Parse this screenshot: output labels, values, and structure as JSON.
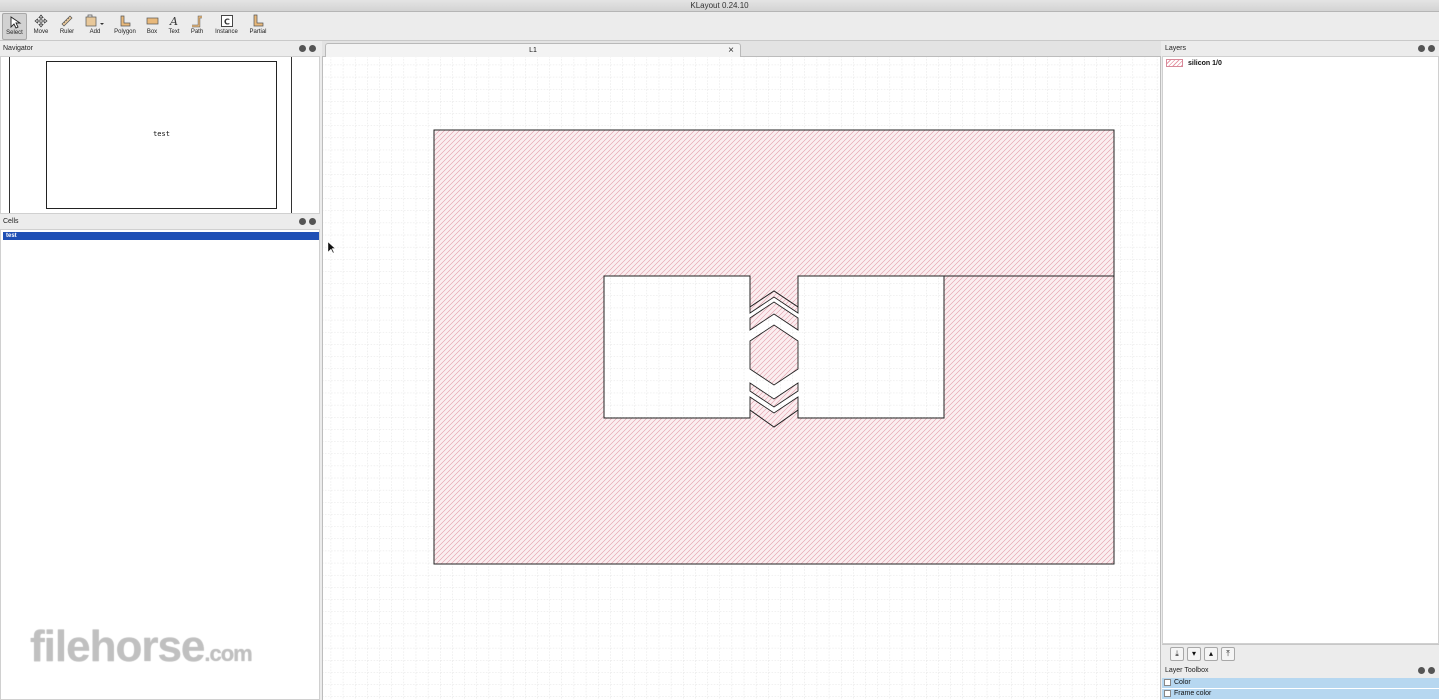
{
  "window": {
    "title": "KLayout 0.24.10"
  },
  "toolbar": {
    "items": [
      {
        "label": "Select",
        "icon": "select-arrow-icon"
      },
      {
        "label": "Move",
        "icon": "move-icon"
      },
      {
        "label": "Ruler",
        "icon": "ruler-icon"
      },
      {
        "label": "Add",
        "icon": "add-icon"
      },
      {
        "label": "Polygon",
        "icon": "polygon-icon"
      },
      {
        "label": "Box",
        "icon": "box-icon"
      },
      {
        "label": "Text",
        "icon": "text-icon"
      },
      {
        "label": "Path",
        "icon": "path-icon"
      },
      {
        "label": "Instance",
        "icon": "instance-icon"
      },
      {
        "label": "Partial",
        "icon": "partial-icon"
      }
    ]
  },
  "navigator": {
    "title": "Navigator",
    "cell_label": "test"
  },
  "cells": {
    "title": "Cells",
    "items": [
      "test"
    ]
  },
  "editor": {
    "tab_label": "L1",
    "close_glyph": "×"
  },
  "layers": {
    "title": "Layers",
    "items": [
      {
        "name": "silicon 1/0",
        "color": "#e79aa8"
      }
    ]
  },
  "layer_toolbox": {
    "title": "Layer Toolbox",
    "items": [
      "Color",
      "Frame color"
    ]
  },
  "watermark": {
    "text": "filehorse",
    "suffix": ".com"
  }
}
